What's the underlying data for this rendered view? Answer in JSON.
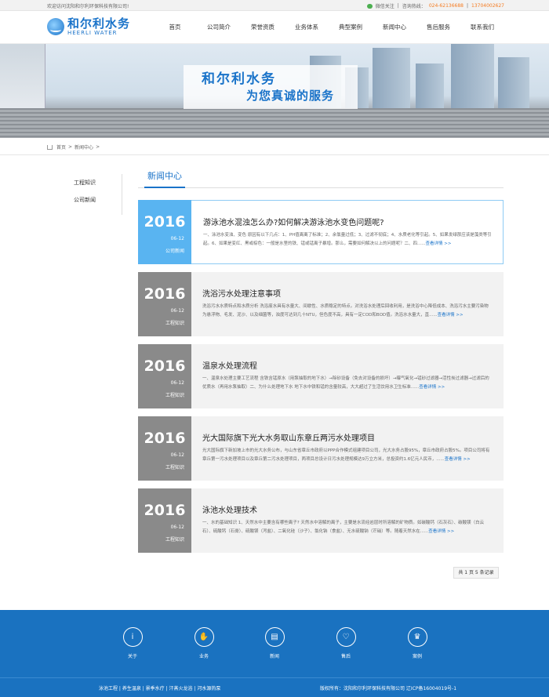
{
  "topbar": {
    "welcome": "欢迎访问沈阳和尔利环保科技有限公司!",
    "wechat_label": "微信关注",
    "hotline_label": "咨询热线：",
    "phone1": "024-62136688",
    "separator": "|",
    "phone2": "13704002627"
  },
  "logo": {
    "cn": "和尔利水务",
    "en": "HEERLI WATER"
  },
  "nav": [
    "首页",
    "公司简介",
    "荣誉资质",
    "业务体系",
    "典型案例",
    "新闻中心",
    "售后服务",
    "联系我们"
  ],
  "banner": {
    "line1": "和尔利水务",
    "line2": "为您真诚的服务"
  },
  "breadcrumb": {
    "home": "首页",
    "sep": ">",
    "current": "新闻中心",
    "sep2": ">"
  },
  "sidebar": [
    "工程知识",
    "公司新闻"
  ],
  "section_title": "新闻中心",
  "news": [
    {
      "year": "2016",
      "date": "06-12",
      "category": "公司新闻",
      "title": "游泳池水混浊怎么办?如何解决游泳池水变色问题呢?",
      "desc": "一、泳池水变浊、变色 原因有以下几点：1、PH值离离了标准；2、余氯量过低；3、过滤不彻底；4、水质老化等引起。5、如果发绿那应该是藻类等引起。6、如果是变红、黑或棕色：一般是水里的铁、锰或锰离子暴增。那么，需要如何解决以上的问题呢？二、四......",
      "more": "查看详情 >>"
    },
    {
      "year": "2016",
      "date": "06-12",
      "category": "工程知识",
      "title": "洗浴污水处理注意事项",
      "desc": "洗浴污水水质特点和水质分析 洗浴废水具有水量大、间歇性、水质稳定的特点。对洗浴水处理后回收利用，是洗浴中心降低成本、洗浴污水主要污染物为悬浮物、毛发、泥沙、以及细菌等，浊度可达到几十NTU，但色度不高，具有一定COD和BOD值。洗浴水水量大，直......",
      "more": "查看详情 >>"
    },
    {
      "year": "2016",
      "date": "06-12",
      "category": "工程知识",
      "title": "温泉水处理流程",
      "desc": "一、温泉水处理主要工艺流程 含铁含锰原水（用泵抽取的地下水）→除砂设备（免去对设备的损坏）→曝气氧化→锰砂过滤器→活性炭过滤器→过滤后的优质水（再用水泵抽取）二、为什么处理地下水 地下水中铁和锰的含量较高，大大超过了生活饮用水卫生标准......",
      "more": "查看详情 >>"
    },
    {
      "year": "2016",
      "date": "06-12",
      "category": "工程知识",
      "title": "光大国际旗下光大水务取山东章丘两污水处理项目",
      "desc": "光大国际旗下新加坡上市的光大水务公布，与山东省章丘市政府以PPP合作模式组建项目公司，光大水务占股95%，章丘市政府占股5%。项目公司将有章丘第一污水处理项目以及章丘第二污水处理项目，两项目总设计日污水处理规模达9万立方米，总投资约1.6亿元人民币，......",
      "more": "查看详情 >>"
    },
    {
      "year": "2016",
      "date": "06-12",
      "category": "工程知识",
      "title": "泳池水处理技术",
      "desc": "一、水的基础知识 1、天然水中主要含有哪些离子? 天然水中溶解的离子，主要是水流经岩层时所溶解的矿物质。如碳酸钙（石灰石）、碳酸镁（白云石）、硫酸钙（石膏）、硫酸镁（泻盐）、二氧化硅（沙子）、氯化钠（食盐）、无水硫酸钠（芒硝）等。随着天然水在......",
      "more": "查看详情 >>"
    }
  ],
  "pager": "共 1 页 5 条记录",
  "footer": {
    "icons": [
      {
        "label": "关于",
        "icon": "info-icon"
      },
      {
        "label": "业务",
        "icon": "handshake-icon"
      },
      {
        "label": "新闻",
        "icon": "news-icon"
      },
      {
        "label": "售后",
        "icon": "heart-icon"
      },
      {
        "label": "案例",
        "icon": "crown-icon"
      }
    ],
    "links": "泳池工程 | 养生温泉 | 景季水疗 | 汗蒸火龙浴 | 河水源热泵",
    "copyright": "版权所有：沈阳和尔利环保科技有限公司 辽ICP备16004019号-1"
  }
}
